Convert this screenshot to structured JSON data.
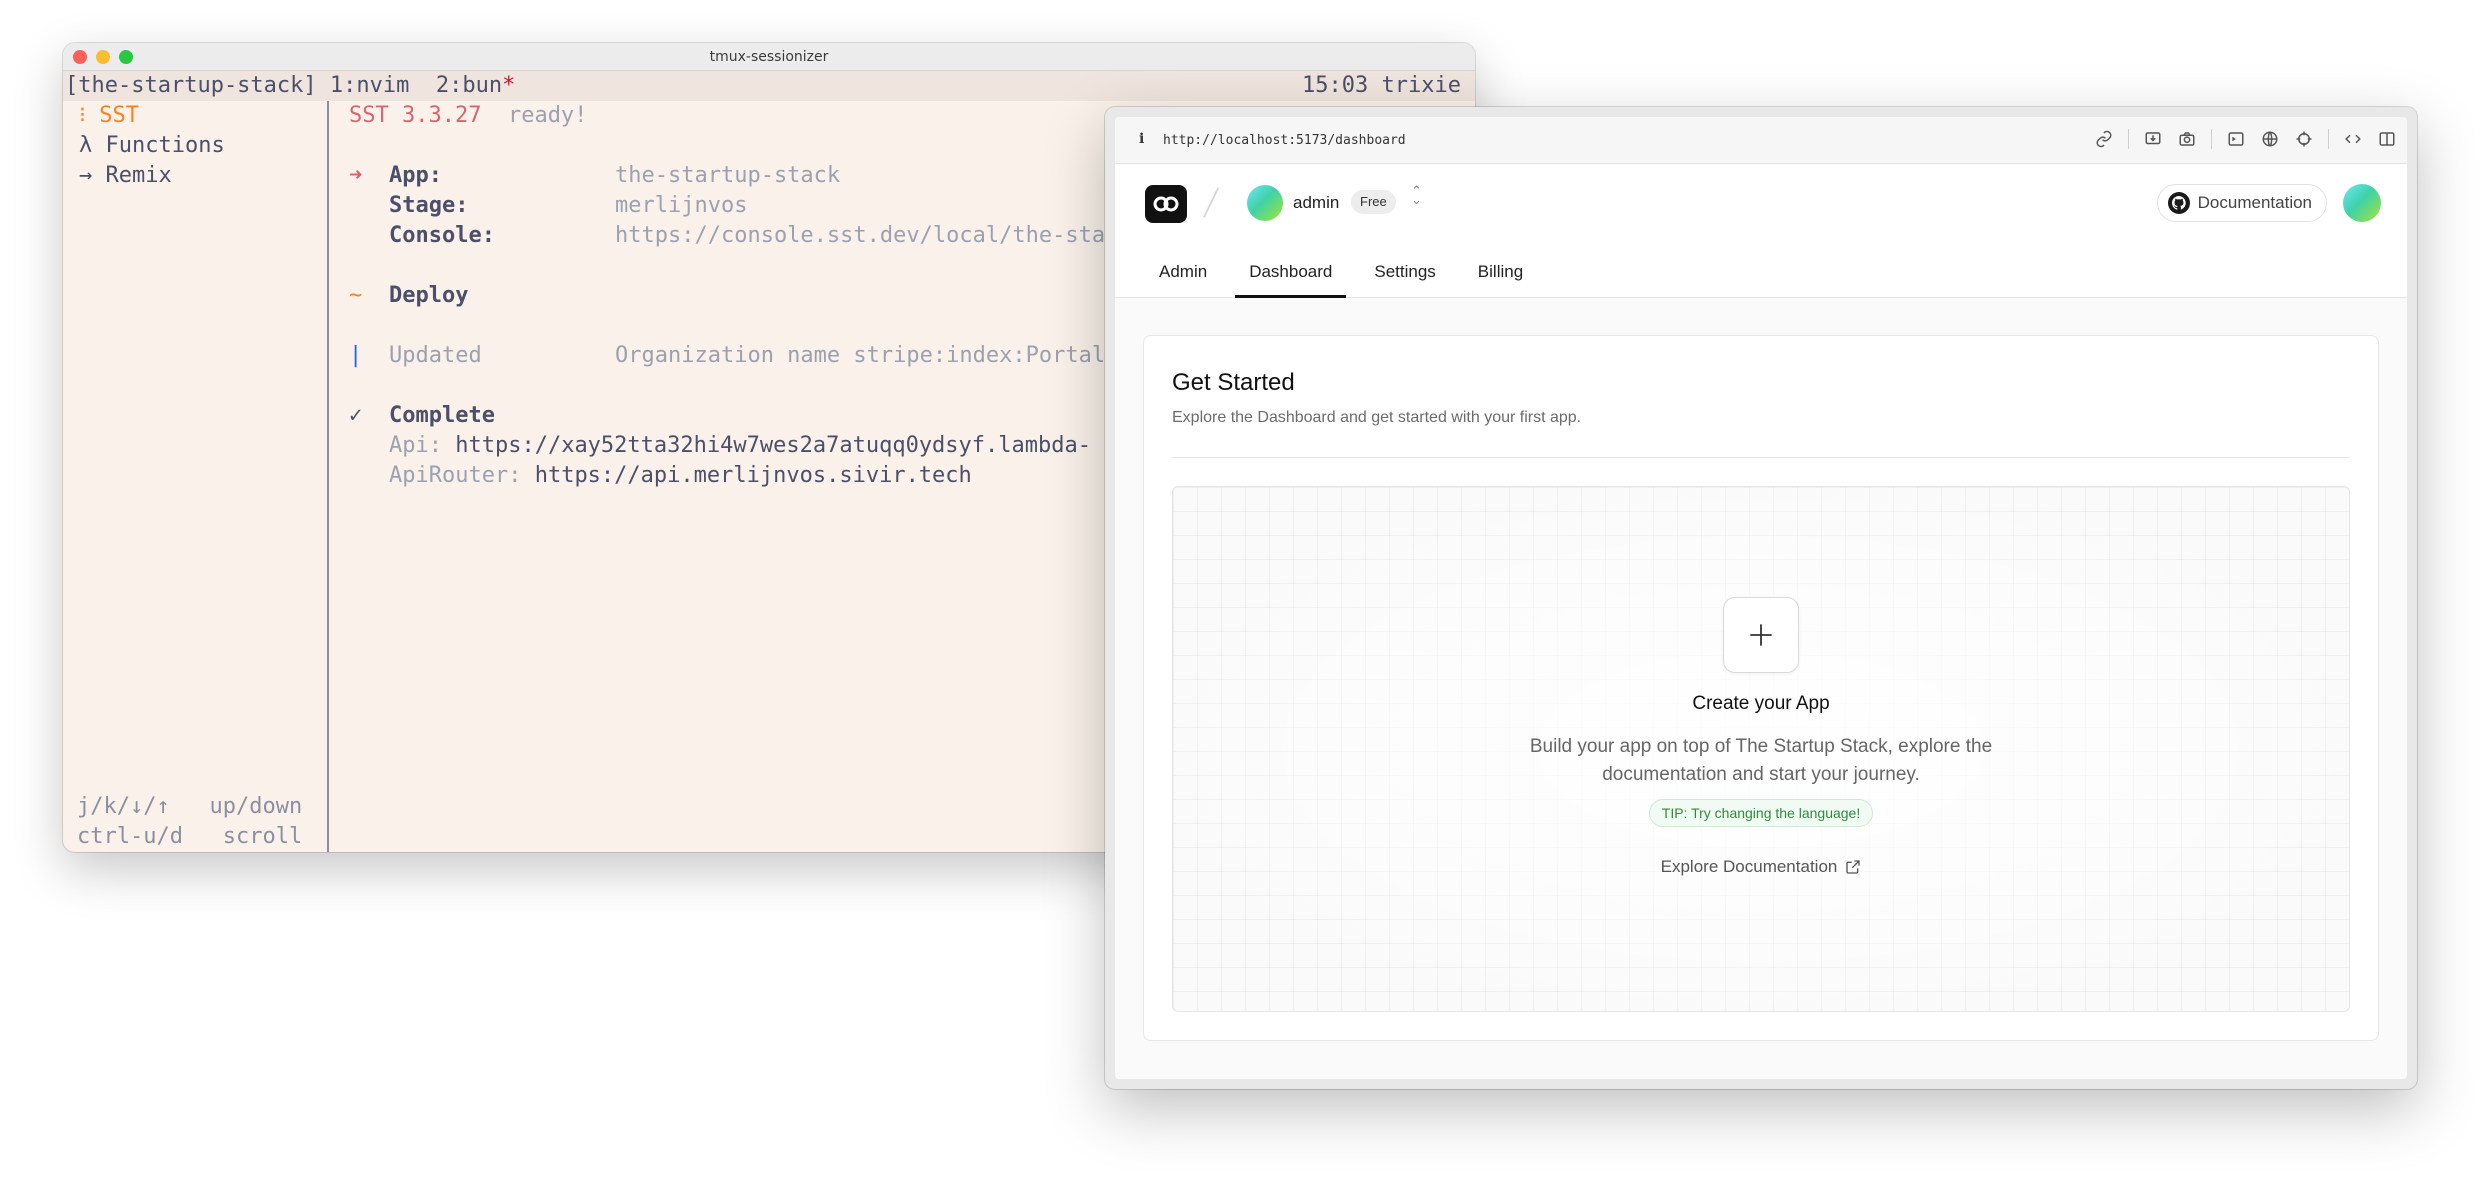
{
  "terminal": {
    "window_title": "tmux-sessionizer",
    "tmux": {
      "session": "[the-startup-stack]",
      "windows": [
        " 1:nvim",
        "  2:bun"
      ],
      "active_marker": "*",
      "right": "15:03 trixie"
    },
    "sidebar": {
      "items": [
        {
          "icon": "⁝",
          "label": "SST"
        },
        {
          "icon": "λ",
          "label": "Functions"
        },
        {
          "icon": "→",
          "label": "Remix"
        }
      ],
      "hints": [
        {
          "keys": "j/k/↓/↑",
          "action": "up/down"
        },
        {
          "keys": "ctrl-u/d",
          "action": "scroll"
        }
      ]
    },
    "output": {
      "version": "SST 3.3.27",
      "ready": "ready!",
      "arrow": "➜",
      "app_label": "App:",
      "app_value": "the-startup-stack",
      "stage_label": "Stage:",
      "stage_value": "merlijnvos",
      "console_label": "Console:",
      "console_value": "https://console.sst.dev/local/the-startup",
      "deploy_sym": "~",
      "deploy": "Deploy",
      "updated_sym": "|",
      "updated": "Updated",
      "updated_value": "Organization name stripe:index:PortalConf",
      "complete_sym": "✓",
      "complete": "Complete",
      "api_label": "Api:",
      "api_value": "https://xay52tta32hi4w7wes2a7atuqq0ydsyf.lambda-",
      "router_label": "ApiRouter:",
      "router_value": "https://api.merlijnvos.sivir.tech"
    }
  },
  "browser": {
    "url": "http://localhost:5173/dashboard",
    "toolbar_icons": [
      "link-icon",
      "install-icon",
      "camera-icon",
      "terminal-icon",
      "globe-icon",
      "crosshair-icon",
      "code-icon",
      "split-view-icon"
    ],
    "org": {
      "name": "admin",
      "plan": "Free"
    },
    "docs_button": "Documentation",
    "tabs": [
      {
        "label": "Admin",
        "active": false
      },
      {
        "label": "Dashboard",
        "active": true
      },
      {
        "label": "Settings",
        "active": false
      },
      {
        "label": "Billing",
        "active": false
      }
    ],
    "card": {
      "title": "Get Started",
      "subtitle": "Explore the Dashboard and get started with your first app.",
      "empty_title": "Create your App",
      "empty_desc": "Build your app on top of The Startup Stack, explore the documentation and start your journey.",
      "tip": "TIP: Try changing the language!",
      "explore": "Explore Documentation"
    }
  }
}
